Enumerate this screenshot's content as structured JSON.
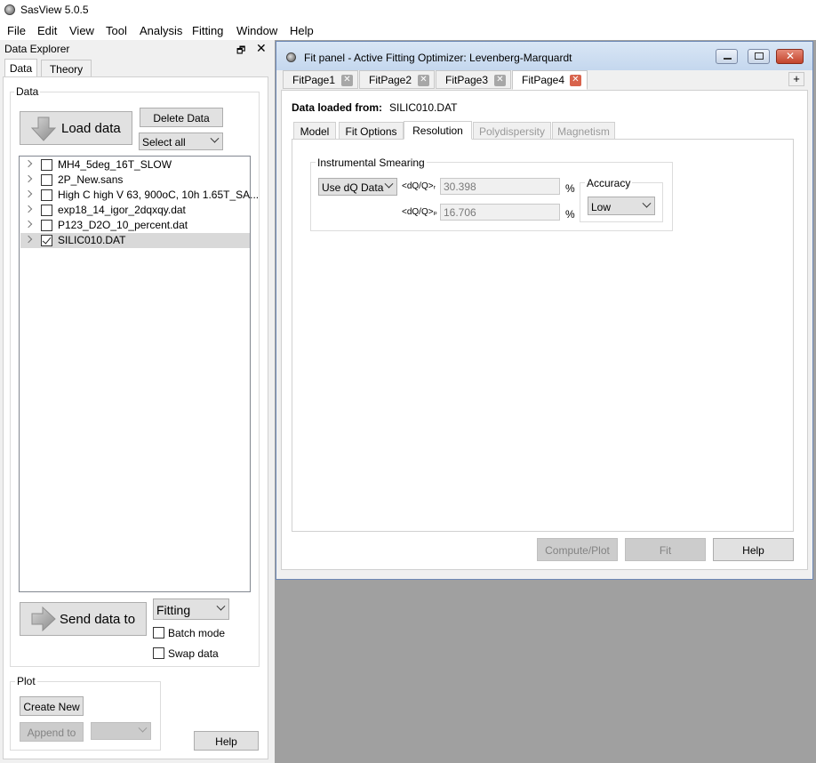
{
  "app": {
    "title": "SasView 5.0.5"
  },
  "menubar": [
    "File",
    "Edit",
    "View",
    "Tool",
    "Analysis",
    "Fitting",
    "Window",
    "Help"
  ],
  "data_explorer": {
    "title": "Data Explorer",
    "float_icon": "float-icon",
    "close_icon": "close-icon",
    "tabs": [
      "Data",
      "Theory"
    ],
    "data_group_label": "Data",
    "load_button": "Load data",
    "delete_button": "Delete Data",
    "select_combo": "Select all",
    "files": [
      {
        "name": "MH4_5deg_16T_SLOW",
        "checked": false
      },
      {
        "name": "2P_New.sans",
        "checked": false
      },
      {
        "name": "High C high V 63, 900oC, 10h 1.65T_SA...",
        "checked": false
      },
      {
        "name": "exp18_14_igor_2dqxqy.dat",
        "checked": false
      },
      {
        "name": "P123_D2O_10_percent.dat",
        "checked": false
      },
      {
        "name": "SILIC010.DAT",
        "checked": true
      }
    ],
    "send_button": "Send data to",
    "send_combo": "Fitting",
    "batch_mode": "Batch mode",
    "swap_data": "Swap data",
    "plot_group_label": "Plot",
    "create_new": "Create New",
    "append_to": "Append to",
    "help": "Help"
  },
  "fit_panel": {
    "title": "Fit panel - Active Fitting Optimizer: Levenberg-Marquardt",
    "pages": [
      "FitPage1",
      "FitPage2",
      "FitPage3",
      "FitPage4"
    ],
    "add_tab": "+",
    "loaded_label": "Data loaded from:",
    "loaded_file": "SILIC010.DAT",
    "sub_tabs": [
      "Model",
      "Fit Options",
      "Resolution",
      "Polydispersity",
      "Magnetism"
    ],
    "smearing_group": "Instrumental Smearing",
    "smearing_combo": "Use dQ Data",
    "dq_perp_label": "<dQ/Q>ᵣ",
    "dq_perp_value": "30.398",
    "dq_par_label": "<dQ/Q>ₚ",
    "dq_par_value": "16.706",
    "percent": "%",
    "accuracy_group": "Accuracy",
    "accuracy_combo": "Low",
    "compute_button": "Compute/Plot",
    "fit_button": "Fit",
    "help_button": "Help"
  }
}
